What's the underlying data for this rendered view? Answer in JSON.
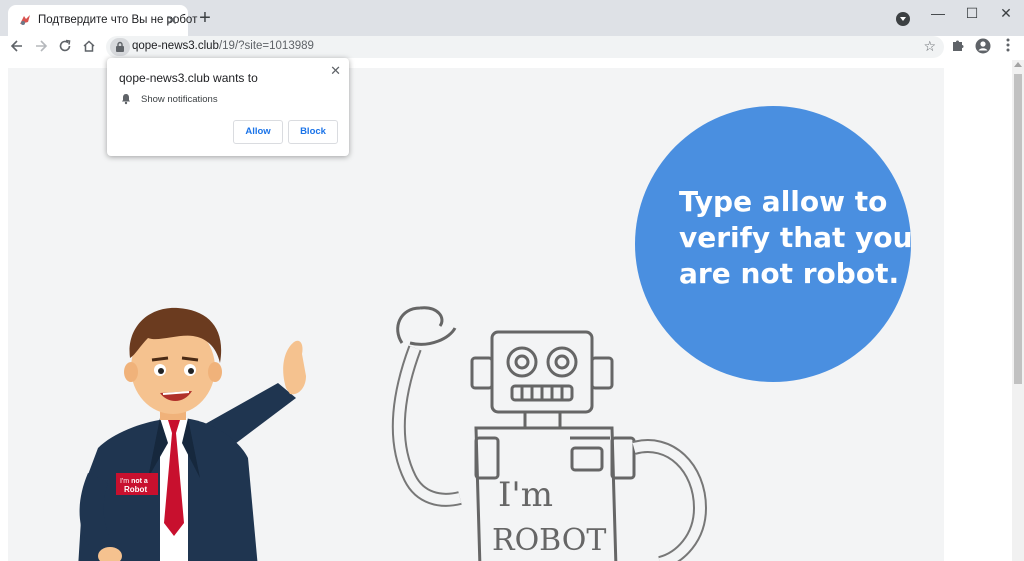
{
  "tab": {
    "title": "Подтвердите что Вы не робот",
    "close_label": "✕"
  },
  "newtab_label": "+",
  "window": {
    "minimize": "—",
    "maximize": "☐",
    "close": "✕"
  },
  "toolbar": {
    "url_host": "qope-news3.club",
    "url_path": "/19/?site=1013989"
  },
  "prompt": {
    "origin": "qope-news3.club wants to",
    "permission": "Show notifications",
    "allow_label": "Allow",
    "block_label": "Block",
    "close_label": "✕"
  },
  "page": {
    "message_lines": [
      "Type allow to",
      "verify that you",
      "are not robot."
    ],
    "badge_line1_a": "I'm",
    "badge_line1_b": "not a",
    "badge_line2": "Robot",
    "robot_text_1": "I'm",
    "robot_text_2": "ROBOT",
    "circle_color": "#4a8fe0"
  }
}
